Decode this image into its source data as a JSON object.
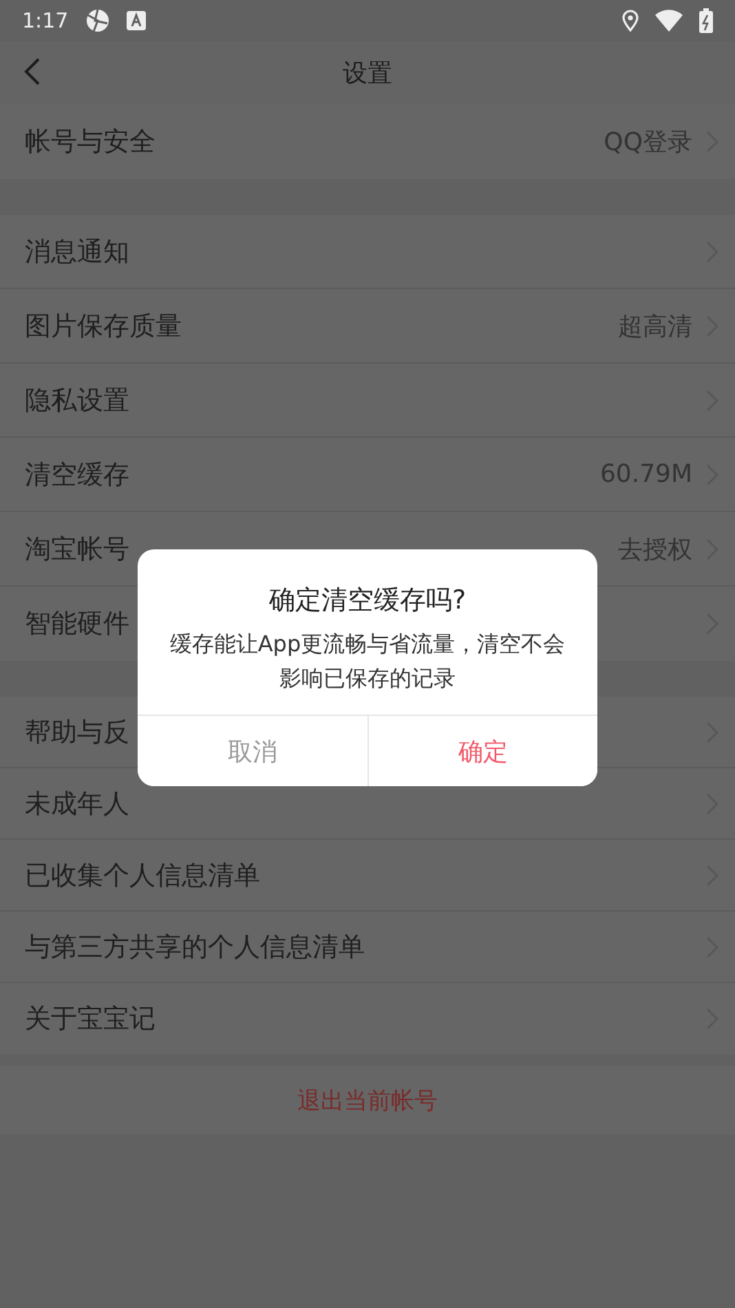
{
  "status_bar": {
    "time": "1:17"
  },
  "header": {
    "title": "设置"
  },
  "groups": [
    {
      "rows": [
        {
          "label": "帐号与安全",
          "value": "QQ登录"
        }
      ]
    },
    {
      "rows": [
        {
          "label": "消息通知"
        },
        {
          "label": "图片保存质量",
          "value": "超高清"
        },
        {
          "label": "隐私设置"
        },
        {
          "label": "清空缓存",
          "value": "60.79M"
        },
        {
          "label": "淘宝帐号",
          "value": "去授权"
        },
        {
          "label": "智能硬件"
        }
      ]
    },
    {
      "rows": [
        {
          "label": "帮助与反"
        },
        {
          "label": "未成年人"
        },
        {
          "label": "已收集个人信息清单"
        },
        {
          "label": "与第三方共享的个人信息清单"
        },
        {
          "label": "关于宝宝记"
        }
      ]
    }
  ],
  "logout": "退出当前帐号",
  "dialog": {
    "title": "确定清空缓存吗?",
    "message": "缓存能让App更流畅与省流量，清空不会影响已保存的记录",
    "buttons": [
      {
        "label": "取消",
        "kind": "cancel"
      },
      {
        "label": "确定",
        "kind": "confirm"
      }
    ]
  }
}
